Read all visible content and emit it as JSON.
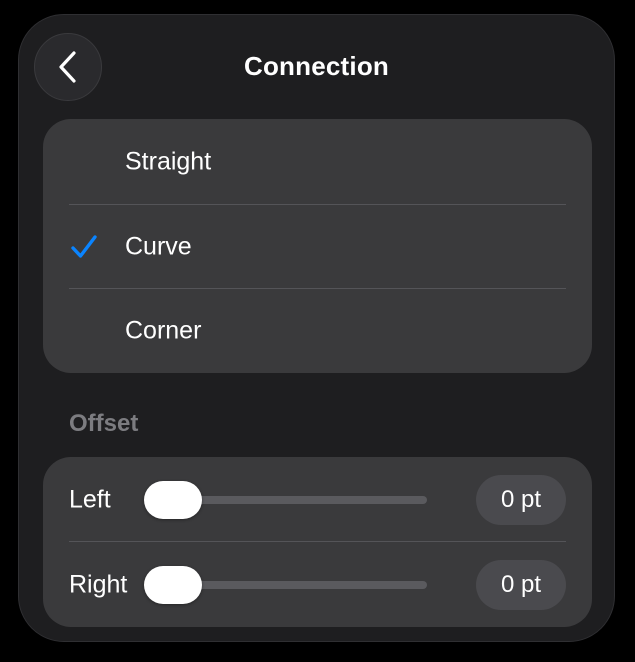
{
  "header": {
    "title": "Connection",
    "back_icon": "chevron-left-icon"
  },
  "connection_types": {
    "options": [
      {
        "label": "Straight",
        "selected": false
      },
      {
        "label": "Curve",
        "selected": true
      },
      {
        "label": "Corner",
        "selected": false
      }
    ],
    "check_icon": "checkmark-icon",
    "accent_color": "#0a84ff"
  },
  "offset": {
    "section_label": "Offset",
    "left": {
      "label": "Left",
      "value": 0,
      "value_text": "0 pt"
    },
    "right": {
      "label": "Right",
      "value": 0,
      "value_text": "0 pt"
    }
  }
}
